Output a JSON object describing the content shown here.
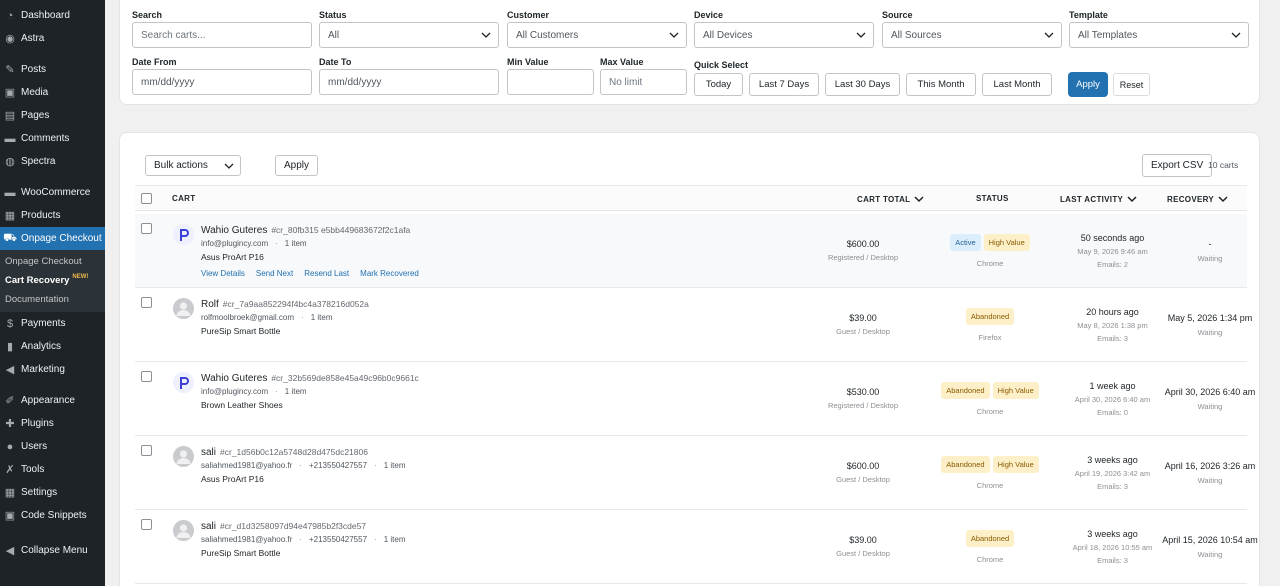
{
  "sidebar": {
    "items": [
      {
        "label": "Dashboard",
        "icon": "dashboard-icon"
      },
      {
        "label": "Astra",
        "icon": "astra-icon"
      },
      {
        "label": "Posts",
        "icon": "pin-icon"
      },
      {
        "label": "Media",
        "icon": "media-icon"
      },
      {
        "label": "Pages",
        "icon": "pages-icon"
      },
      {
        "label": "Comments",
        "icon": "comment-icon"
      },
      {
        "label": "Spectra",
        "icon": "spectra-icon"
      },
      {
        "label": "WooCommerce",
        "icon": "woo-icon"
      },
      {
        "label": "Products",
        "icon": "products-icon"
      },
      {
        "label": "Onpage Checkout",
        "icon": "cart-icon"
      },
      {
        "label": "Payments",
        "icon": "payments-icon"
      },
      {
        "label": "Analytics",
        "icon": "analytics-icon"
      },
      {
        "label": "Marketing",
        "icon": "megaphone-icon"
      },
      {
        "label": "Appearance",
        "icon": "brush-icon"
      },
      {
        "label": "Plugins",
        "icon": "plugin-icon"
      },
      {
        "label": "Users",
        "icon": "users-icon"
      },
      {
        "label": "Tools",
        "icon": "wrench-icon"
      },
      {
        "label": "Settings",
        "icon": "settings-icon"
      },
      {
        "label": "Code Snippets",
        "icon": "code-icon"
      },
      {
        "label": "Collapse Menu",
        "icon": "collapse-icon"
      }
    ],
    "submenu": [
      {
        "label": "Onpage Checkout"
      },
      {
        "label": "Cart Recovery",
        "badge": "NEW!"
      },
      {
        "label": "Documentation"
      }
    ]
  },
  "filters": {
    "search_label": "Search",
    "search_placeholder": "Search carts...",
    "status_label": "Status",
    "status_value": "All",
    "customer_label": "Customer",
    "customer_value": "All Customers",
    "device_label": "Device",
    "device_value": "All Devices",
    "source_label": "Source",
    "source_value": "All Sources",
    "template_label": "Template",
    "template_value": "All Templates",
    "date_from_label": "Date From",
    "date_from_placeholder": "mm/dd/yyyy",
    "date_to_label": "Date To",
    "date_to_placeholder": "mm/dd/yyyy",
    "min_label": "Min Value",
    "max_label": "Max Value",
    "max_placeholder": "No limit",
    "quick_label": "Quick Select",
    "quick": [
      "Today",
      "Last 7 Days",
      "Last 30 Days",
      "This Month",
      "Last Month"
    ],
    "apply": "Apply",
    "reset": "Reset"
  },
  "table": {
    "bulk_actions": "Bulk actions",
    "apply": "Apply",
    "export": "Export CSV",
    "count": "10 carts",
    "headers": {
      "cart": "CART",
      "total": "CART TOTAL",
      "status": "STATUS",
      "activity": "LAST ACTIVITY",
      "recovery": "RECOVERY"
    },
    "row_actions": [
      "View Details",
      "Send Next",
      "Resend Last",
      "Mark Recovered"
    ],
    "rows": [
      {
        "name": "Wahio Guteres",
        "id": "#cr_80fb315 e5bb449683672f2c1afa",
        "email": "info@plugincy.com",
        "phone": "",
        "items": "1 item",
        "product": "Asus ProArt P16",
        "total": "$600.00",
        "source": "Registered / Desktop",
        "badges": [
          "Active",
          "High Value"
        ],
        "browser": "Chrome",
        "ago": "50 seconds ago",
        "date": "May 9, 2026 9:46 am",
        "emails": "Emails: 2",
        "recovery": "-",
        "recovery_status": "Waiting",
        "avatar": "brand"
      },
      {
        "name": "Rolf",
        "id": "#cr_7a9aa852294f4bc4a378216d052a",
        "email": "rolfmoolbroek@gmail.com",
        "phone": "",
        "items": "1 item",
        "product": "PureSip Smart Bottle",
        "total": "$39.00",
        "source": "Guest / Desktop",
        "badges": [
          "Abandoned"
        ],
        "browser": "Firefox",
        "ago": "20 hours ago",
        "date": "May 8, 2026 1:38 pm",
        "emails": "Emails: 3",
        "recovery": "May 5, 2026 1:34 pm",
        "recovery_status": "Waiting",
        "avatar": "gen"
      },
      {
        "name": "Wahio Guteres",
        "id": "#cr_32b569de858e45a49c96b0c9661c",
        "email": "info@plugincy.com",
        "phone": "",
        "items": "1 item",
        "product": "Brown Leather Shoes",
        "total": "$530.00",
        "source": "Registered / Desktop",
        "badges": [
          "Abandoned",
          "High Value"
        ],
        "browser": "Chrome",
        "ago": "1 week ago",
        "date": "April 30, 2026 6:40 am",
        "emails": "Emails: 0",
        "recovery": "April 30, 2026 6:40 am",
        "recovery_status": "Waiting",
        "avatar": "brand"
      },
      {
        "name": "sali",
        "id": "#cr_1d56b0c12a5748d28d475dc21806",
        "email": "saliahmed1981@yahoo.fr",
        "phone": "+213550427557",
        "items": "1 item",
        "product": "Asus ProArt P16",
        "total": "$600.00",
        "source": "Guest / Desktop",
        "badges": [
          "Abandoned",
          "High Value"
        ],
        "browser": "Chrome",
        "ago": "3 weeks ago",
        "date": "April 19, 2026 3:42 am",
        "emails": "Emails: 3",
        "recovery": "April 16, 2026 3:26 am",
        "recovery_status": "Waiting",
        "avatar": "gen"
      },
      {
        "name": "sali",
        "id": "#cr_d1d3258097d94e47985b2f3cde57",
        "email": "saliahmed1981@yahoo.fr",
        "phone": "+213550427557",
        "items": "1 item",
        "product": "PureSip Smart Bottle",
        "total": "$39.00",
        "source": "Guest / Desktop",
        "badges": [
          "Abandoned"
        ],
        "browser": "Chrome",
        "ago": "3 weeks ago",
        "date": "April 18, 2026 10:55 am",
        "emails": "Emails: 3",
        "recovery": "April 15, 2026 10:54 am",
        "recovery_status": "Waiting",
        "avatar": "gen"
      }
    ]
  },
  "colors": {
    "accent": "#2271b1",
    "sidebar": "#1d2327",
    "active_badge": "#dbeefc",
    "warn_badge": "#fdf0c8"
  }
}
